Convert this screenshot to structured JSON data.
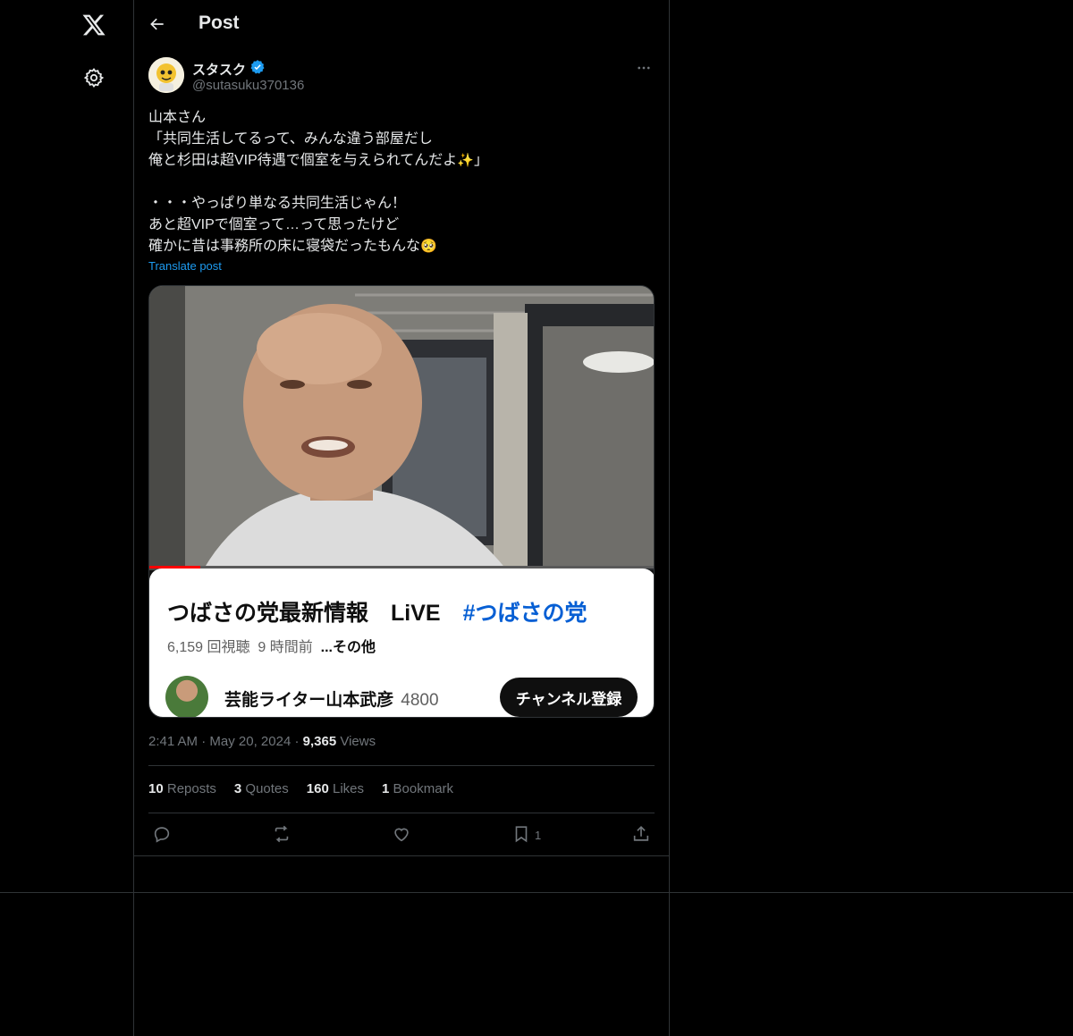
{
  "header": {
    "title": "Post"
  },
  "author": {
    "display_name": "スタスク",
    "handle": "@sutasuku370136",
    "verified": true
  },
  "post": {
    "text_line1": "山本さん",
    "text_line2": "「共同生活してるって、みんな違う部屋だし",
    "text_line3": "俺と杉田は超VIP待遇で個室を与えられてんだよ",
    "text_line3_emoji": "✨",
    "text_line3_end": "」",
    "text_line5": "・・・やっぱり単なる共同生活じゃん！",
    "text_line6": "あと超VIPで個室って…って思ったけど",
    "text_line7": "確かに昔は事務所の床に寝袋だったもんな",
    "text_line7_emoji": "🥺",
    "translate_label": "Translate post"
  },
  "media": {
    "card_title": "つばさの党最新情報　LiVE",
    "card_hashtag": "#つばさの党",
    "card_views": "6,159 回視聴",
    "card_time": "9 時間前",
    "card_more": "...その他",
    "channel_name": "芸能ライター山本武彦",
    "channel_subs": "4800",
    "subscribe_label": "チャンネル登録",
    "progress_fraction": 0.1
  },
  "meta": {
    "time": "2:41 AM",
    "sep1": "·",
    "date": "May 20, 2024",
    "sep2": "·",
    "views_count": "9,365",
    "views_label": "Views"
  },
  "stats": {
    "reposts_count": "10",
    "reposts_label": "Reposts",
    "quotes_count": "3",
    "quotes_label": "Quotes",
    "likes_count": "160",
    "likes_label": "Likes",
    "bookmarks_count": "1",
    "bookmarks_label": "Bookmark"
  },
  "actions": {
    "bookmark_count": "1"
  },
  "colors": {
    "accent": "#1d9bf0",
    "background": "#000000",
    "text": "#e7e9ea",
    "muted": "#71767b",
    "border": "#2f3336"
  }
}
